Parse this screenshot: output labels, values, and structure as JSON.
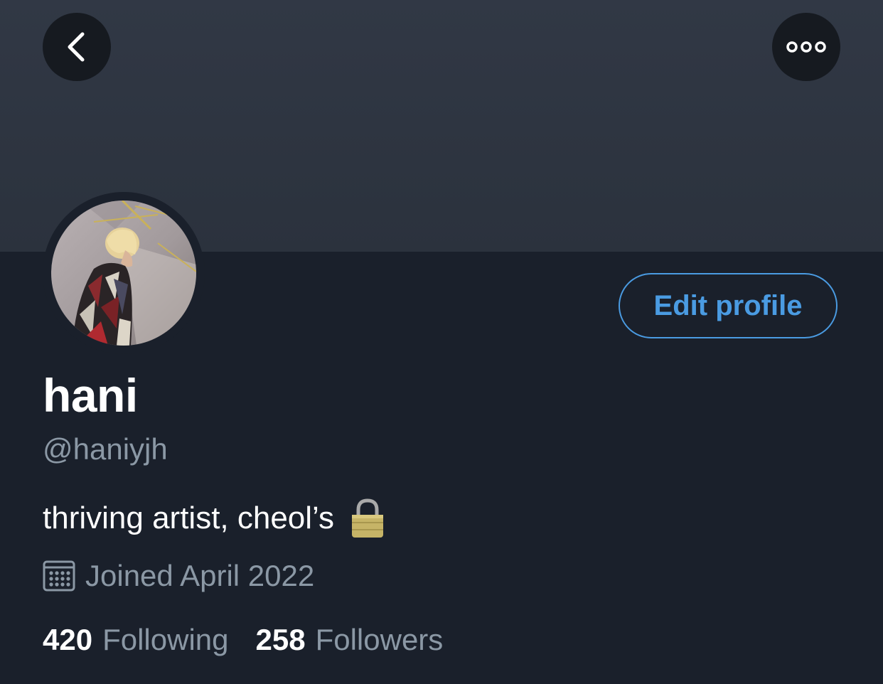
{
  "header": {
    "back_icon": "chevron-left-icon",
    "more_icon": "ellipsis-icon"
  },
  "profile": {
    "display_name": "hani",
    "handle": "@haniyjh",
    "bio": "thriving artist, cheol’s",
    "bio_emoji": "lock-icon",
    "joined": "Joined April 2022",
    "edit_label": "Edit profile"
  },
  "stats": {
    "following_count": "420",
    "following_label": "Following",
    "followers_count": "258",
    "followers_label": "Followers"
  },
  "colors": {
    "background": "#1a202b",
    "banner": "#2f3641",
    "accent": "#4a9be2",
    "secondary_text": "#8b98a5",
    "primary_text": "#ffffff"
  }
}
